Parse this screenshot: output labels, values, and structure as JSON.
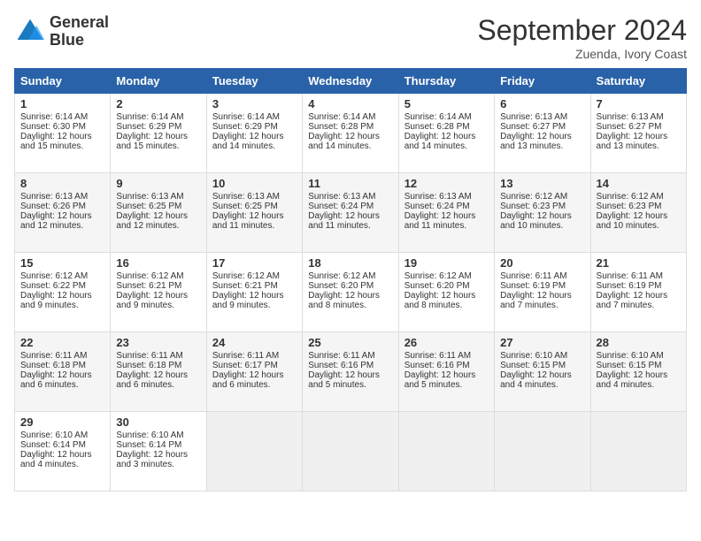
{
  "logo": {
    "line1": "General",
    "line2": "Blue"
  },
  "title": "September 2024",
  "location": "Zuenda, Ivory Coast",
  "headers": [
    "Sunday",
    "Monday",
    "Tuesday",
    "Wednesday",
    "Thursday",
    "Friday",
    "Saturday"
  ],
  "weeks": [
    [
      {
        "day": "1",
        "sunrise": "Sunrise: 6:14 AM",
        "sunset": "Sunset: 6:30 PM",
        "daylight": "Daylight: 12 hours and 15 minutes."
      },
      {
        "day": "2",
        "sunrise": "Sunrise: 6:14 AM",
        "sunset": "Sunset: 6:29 PM",
        "daylight": "Daylight: 12 hours and 15 minutes."
      },
      {
        "day": "3",
        "sunrise": "Sunrise: 6:14 AM",
        "sunset": "Sunset: 6:29 PM",
        "daylight": "Daylight: 12 hours and 14 minutes."
      },
      {
        "day": "4",
        "sunrise": "Sunrise: 6:14 AM",
        "sunset": "Sunset: 6:28 PM",
        "daylight": "Daylight: 12 hours and 14 minutes."
      },
      {
        "day": "5",
        "sunrise": "Sunrise: 6:14 AM",
        "sunset": "Sunset: 6:28 PM",
        "daylight": "Daylight: 12 hours and 14 minutes."
      },
      {
        "day": "6",
        "sunrise": "Sunrise: 6:13 AM",
        "sunset": "Sunset: 6:27 PM",
        "daylight": "Daylight: 12 hours and 13 minutes."
      },
      {
        "day": "7",
        "sunrise": "Sunrise: 6:13 AM",
        "sunset": "Sunset: 6:27 PM",
        "daylight": "Daylight: 12 hours and 13 minutes."
      }
    ],
    [
      {
        "day": "8",
        "sunrise": "Sunrise: 6:13 AM",
        "sunset": "Sunset: 6:26 PM",
        "daylight": "Daylight: 12 hours and 12 minutes."
      },
      {
        "day": "9",
        "sunrise": "Sunrise: 6:13 AM",
        "sunset": "Sunset: 6:25 PM",
        "daylight": "Daylight: 12 hours and 12 minutes."
      },
      {
        "day": "10",
        "sunrise": "Sunrise: 6:13 AM",
        "sunset": "Sunset: 6:25 PM",
        "daylight": "Daylight: 12 hours and 11 minutes."
      },
      {
        "day": "11",
        "sunrise": "Sunrise: 6:13 AM",
        "sunset": "Sunset: 6:24 PM",
        "daylight": "Daylight: 12 hours and 11 minutes."
      },
      {
        "day": "12",
        "sunrise": "Sunrise: 6:13 AM",
        "sunset": "Sunset: 6:24 PM",
        "daylight": "Daylight: 12 hours and 11 minutes."
      },
      {
        "day": "13",
        "sunrise": "Sunrise: 6:12 AM",
        "sunset": "Sunset: 6:23 PM",
        "daylight": "Daylight: 12 hours and 10 minutes."
      },
      {
        "day": "14",
        "sunrise": "Sunrise: 6:12 AM",
        "sunset": "Sunset: 6:23 PM",
        "daylight": "Daylight: 12 hours and 10 minutes."
      }
    ],
    [
      {
        "day": "15",
        "sunrise": "Sunrise: 6:12 AM",
        "sunset": "Sunset: 6:22 PM",
        "daylight": "Daylight: 12 hours and 9 minutes."
      },
      {
        "day": "16",
        "sunrise": "Sunrise: 6:12 AM",
        "sunset": "Sunset: 6:21 PM",
        "daylight": "Daylight: 12 hours and 9 minutes."
      },
      {
        "day": "17",
        "sunrise": "Sunrise: 6:12 AM",
        "sunset": "Sunset: 6:21 PM",
        "daylight": "Daylight: 12 hours and 9 minutes."
      },
      {
        "day": "18",
        "sunrise": "Sunrise: 6:12 AM",
        "sunset": "Sunset: 6:20 PM",
        "daylight": "Daylight: 12 hours and 8 minutes."
      },
      {
        "day": "19",
        "sunrise": "Sunrise: 6:12 AM",
        "sunset": "Sunset: 6:20 PM",
        "daylight": "Daylight: 12 hours and 8 minutes."
      },
      {
        "day": "20",
        "sunrise": "Sunrise: 6:11 AM",
        "sunset": "Sunset: 6:19 PM",
        "daylight": "Daylight: 12 hours and 7 minutes."
      },
      {
        "day": "21",
        "sunrise": "Sunrise: 6:11 AM",
        "sunset": "Sunset: 6:19 PM",
        "daylight": "Daylight: 12 hours and 7 minutes."
      }
    ],
    [
      {
        "day": "22",
        "sunrise": "Sunrise: 6:11 AM",
        "sunset": "Sunset: 6:18 PM",
        "daylight": "Daylight: 12 hours and 6 minutes."
      },
      {
        "day": "23",
        "sunrise": "Sunrise: 6:11 AM",
        "sunset": "Sunset: 6:18 PM",
        "daylight": "Daylight: 12 hours and 6 minutes."
      },
      {
        "day": "24",
        "sunrise": "Sunrise: 6:11 AM",
        "sunset": "Sunset: 6:17 PM",
        "daylight": "Daylight: 12 hours and 6 minutes."
      },
      {
        "day": "25",
        "sunrise": "Sunrise: 6:11 AM",
        "sunset": "Sunset: 6:16 PM",
        "daylight": "Daylight: 12 hours and 5 minutes."
      },
      {
        "day": "26",
        "sunrise": "Sunrise: 6:11 AM",
        "sunset": "Sunset: 6:16 PM",
        "daylight": "Daylight: 12 hours and 5 minutes."
      },
      {
        "day": "27",
        "sunrise": "Sunrise: 6:10 AM",
        "sunset": "Sunset: 6:15 PM",
        "daylight": "Daylight: 12 hours and 4 minutes."
      },
      {
        "day": "28",
        "sunrise": "Sunrise: 6:10 AM",
        "sunset": "Sunset: 6:15 PM",
        "daylight": "Daylight: 12 hours and 4 minutes."
      }
    ],
    [
      {
        "day": "29",
        "sunrise": "Sunrise: 6:10 AM",
        "sunset": "Sunset: 6:14 PM",
        "daylight": "Daylight: 12 hours and 4 minutes."
      },
      {
        "day": "30",
        "sunrise": "Sunrise: 6:10 AM",
        "sunset": "Sunset: 6:14 PM",
        "daylight": "Daylight: 12 hours and 3 minutes."
      },
      null,
      null,
      null,
      null,
      null
    ]
  ]
}
